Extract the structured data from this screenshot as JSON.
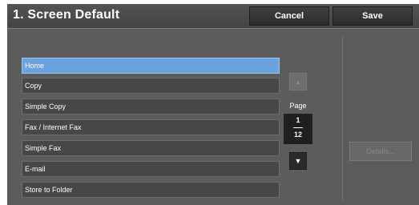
{
  "header": {
    "title": "1. Screen Default",
    "cancel_label": "Cancel",
    "save_label": "Save"
  },
  "list": {
    "items": [
      {
        "label": "Home",
        "selected": true
      },
      {
        "label": "Copy",
        "selected": false
      },
      {
        "label": "Simple Copy",
        "selected": false
      },
      {
        "label": "Fax / Internet Fax",
        "selected": false
      },
      {
        "label": "Simple Fax",
        "selected": false
      },
      {
        "label": "E-mail",
        "selected": false
      },
      {
        "label": "Store to Folder",
        "selected": false
      }
    ]
  },
  "pager": {
    "label": "Page",
    "current": "1",
    "total": "12",
    "up_icon": "triangle-up-icon",
    "down_icon": "triangle-down-icon"
  },
  "side": {
    "details_label": "Details..."
  },
  "colors": {
    "panel": "#5c5c5c",
    "selected": "#6aa2de",
    "item": "#474747",
    "button": "#2c2c2c"
  }
}
